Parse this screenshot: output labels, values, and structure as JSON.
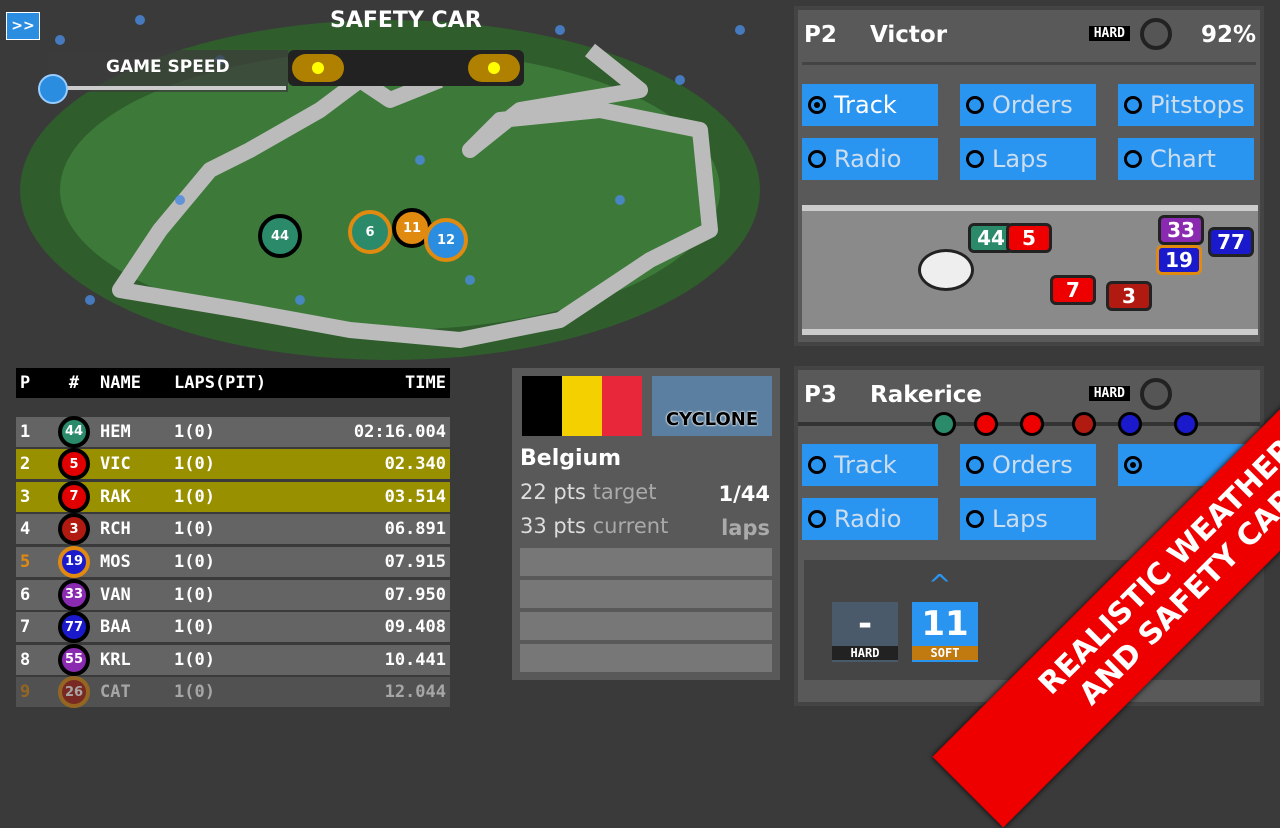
{
  "top": {
    "fast_forward": ">>",
    "safety_car": "SAFETY CAR",
    "game_speed": "GAME SPEED"
  },
  "map": {
    "car_numbers": [
      "44",
      "6",
      "11",
      "12"
    ]
  },
  "standings": {
    "headers": [
      "P",
      "#",
      "NAME",
      "LAPS(PIT)",
      "TIME"
    ],
    "rows": [
      {
        "p": "1",
        "num": "44",
        "name": "HEM",
        "laps": "1(0)",
        "time": "02:16.004",
        "color": "#2a8a6a",
        "ring": "#000"
      },
      {
        "p": "2",
        "num": "5",
        "name": "VIC",
        "laps": "1(0)",
        "time": "02.340",
        "color": "#e00000",
        "ring": "#000"
      },
      {
        "p": "3",
        "num": "7",
        "name": "RAK",
        "laps": "1(0)",
        "time": "03.514",
        "color": "#e00000",
        "ring": "#000"
      },
      {
        "p": "4",
        "num": "3",
        "name": "RCH",
        "laps": "1(0)",
        "time": "06.891",
        "color": "#b01a10",
        "ring": "#000"
      },
      {
        "p": "5",
        "num": "19",
        "name": "MOS",
        "laps": "1(0)",
        "time": "07.915",
        "color": "#1a1acc",
        "ring": "#e08a10"
      },
      {
        "p": "6",
        "num": "33",
        "name": "VAN",
        "laps": "1(0)",
        "time": "07.950",
        "color": "#8a2ab0",
        "ring": "#000"
      },
      {
        "p": "7",
        "num": "77",
        "name": "BAA",
        "laps": "1(0)",
        "time": "09.408",
        "color": "#1a1acc",
        "ring": "#000"
      },
      {
        "p": "8",
        "num": "55",
        "name": "KRL",
        "laps": "1(0)",
        "time": "10.441",
        "color": "#8a2ab0",
        "ring": "#000"
      },
      {
        "p": "9",
        "num": "26",
        "name": "CAT",
        "laps": "1(0)",
        "time": "12.044",
        "color": "#b01a10",
        "ring": "#e08a10"
      }
    ]
  },
  "race": {
    "weather": "CYCLONE",
    "country": "Belgium",
    "target_pts": "22 pts",
    "target_label": "target",
    "current_pts": "33 pts",
    "current_label": "current",
    "lap": "1/44",
    "lap_label": "laps"
  },
  "driver1": {
    "pos": "P2",
    "name": "Victor",
    "tyre": "HARD",
    "condition": "92%",
    "buttons": [
      "Track",
      "Orders",
      "Pitstops",
      "Radio",
      "Laps",
      "Chart"
    ],
    "selected": "Track",
    "cars": [
      "44",
      "5",
      "7",
      "3",
      "33",
      "19",
      "77"
    ]
  },
  "driver2": {
    "pos": "P3",
    "name": "Rakerice",
    "tyre": "HARD",
    "buttons": [
      "Track",
      "Orders",
      "Radio",
      "Laps"
    ],
    "pit": {
      "current_laps": "-",
      "current_tyre": "HARD",
      "next_laps": "11",
      "next_tyre": "SOFT"
    }
  },
  "banner": {
    "line1": "REALISTIC WEATHER",
    "line2": "AND SAFETY CAR!"
  }
}
